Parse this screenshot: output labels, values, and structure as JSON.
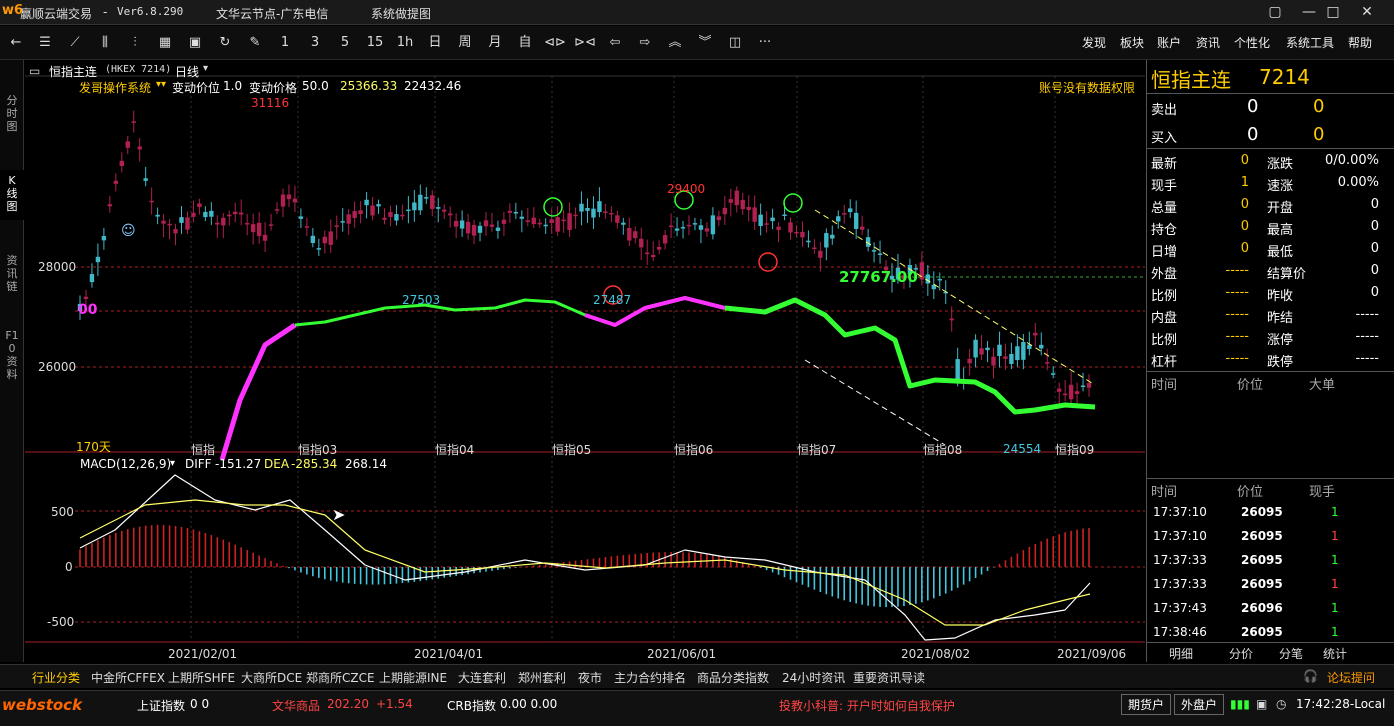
{
  "window": {
    "app_title": "赢顺云端交易",
    "version": "Ver6.8.290",
    "node": "文华云节点-广东电信",
    "notice": "系统做提图",
    "logo_text": "w6"
  },
  "toolbar": {
    "periods": [
      "1",
      "3",
      "5",
      "15",
      "1h",
      "日",
      "周",
      "月",
      "自"
    ],
    "menus": [
      "发现",
      "板块",
      "账户",
      "资讯",
      "个性化",
      "系统工具",
      "帮助"
    ]
  },
  "left_tabs": [
    "分时图",
    "K线图",
    "资讯链",
    "F10资料"
  ],
  "chart": {
    "contract": "恒指主连",
    "exchange": "(HKEX 7214)",
    "period": "日线",
    "indicator_name": "发哥操作系统",
    "tick_label": "变动价位",
    "tick_value": "1.0",
    "price_label": "变动价格",
    "price_value": "50.0",
    "val1": "25366.33",
    "val2": "22432.46",
    "no_permission": "账号没有数据权限",
    "day_count": "170天",
    "marker_left": "00",
    "annotations": {
      "high": "31116",
      "p1": "27503",
      "p2": "27487",
      "p3": "29400",
      "p4": "27767.00",
      "p5": "24554"
    },
    "y_labels": [
      "28000",
      "26000"
    ],
    "x_month_labels": [
      "恒指",
      "恒指03",
      "恒指04",
      "恒指05",
      "恒指06",
      "恒指07",
      "恒指08",
      "恒指09"
    ],
    "macd": {
      "name": "MACD(12,26,9)",
      "diff_label": "DIFF",
      "diff": "-151.27",
      "dea_label": "DEA",
      "dea": "-285.34",
      "macd_val": "268.14",
      "y_labels": [
        "500",
        "0",
        "-500"
      ]
    },
    "dates": [
      "2021/02/01",
      "2021/04/01",
      "2021/06/01",
      "2021/08/02",
      "2021/09/06"
    ],
    "colors": {
      "up": "#b02050",
      "down": "#40b8c8",
      "mid_line_up": "#ff33ff",
      "mid_line_down": "#33ff33",
      "diff": "#ffffff",
      "dea": "#ffff66"
    }
  },
  "quote_panel": {
    "name": "恒指主连",
    "code": "7214",
    "sell_label": "卖出",
    "sell_price": "0",
    "sell_vol": "0",
    "buy_label": "买入",
    "buy_price": "0",
    "buy_vol": "0",
    "rows": [
      {
        "l1": "最新",
        "v1": "0",
        "l2": "涨跌",
        "v2": "0/0.00%"
      },
      {
        "l1": "现手",
        "v1": "1",
        "l2": "速涨",
        "v2": "0.00%"
      },
      {
        "l1": "总量",
        "v1": "0",
        "l2": "开盘",
        "v2": "0"
      },
      {
        "l1": "持仓",
        "v1": "0",
        "l2": "最高",
        "v2": "0"
      },
      {
        "l1": "日增",
        "v1": "0",
        "l2": "最低",
        "v2": "0"
      },
      {
        "l1": "外盘",
        "v1": "-----",
        "l2": "结算价",
        "v2": "0"
      },
      {
        "l1": "比例",
        "v1": "-----",
        "l2": "昨收",
        "v2": "0"
      },
      {
        "l1": "内盘",
        "v1": "-----",
        "l2": "昨结",
        "v2": "-----"
      },
      {
        "l1": "比例",
        "v1": "-----",
        "l2": "涨停",
        "v2": "-----"
      },
      {
        "l1": "杠杆",
        "v1": "-----",
        "l2": "跌停",
        "v2": "-----"
      }
    ],
    "big_header": [
      "时间",
      "价位",
      "大单"
    ],
    "tick_header": [
      "时间",
      "价位",
      "现手"
    ],
    "ticks": [
      {
        "time": "17:37:10",
        "price": "26095",
        "vol": "1",
        "color": "#33ff33"
      },
      {
        "time": "17:37:10",
        "price": "26095",
        "vol": "1",
        "color": "#ff4444"
      },
      {
        "time": "17:37:33",
        "price": "26095",
        "vol": "1",
        "color": "#33ff33"
      },
      {
        "time": "17:37:33",
        "price": "26095",
        "vol": "1",
        "color": "#ff4444"
      },
      {
        "time": "17:37:43",
        "price": "26096",
        "vol": "1",
        "color": "#33ff33"
      },
      {
        "time": "17:38:46",
        "price": "26095",
        "vol": "1",
        "color": "#33ff33"
      }
    ],
    "bottom_tabs": [
      "明细",
      "分价",
      "分笔",
      "统计"
    ]
  },
  "market_tabs": [
    "行业分类",
    "中金所CFFEX",
    "上期所SHFE",
    "大商所DCE",
    "郑商所CZCE",
    "上期能源INE",
    "大连套利",
    "郑州套利",
    "夜市",
    "主力合约排名",
    "商品分类指数",
    "24小时资讯",
    "重要资讯导读"
  ],
  "forum": "论坛提问",
  "status": {
    "logo": "webstock",
    "idx1_name": "上证指数",
    "idx1_val": "0 0",
    "idx2_name": "文华商品",
    "idx2_val": "202.20",
    "idx2_chg": "+1.54",
    "idx3_name": "CRB指数",
    "idx3_val": "0.00 0.00",
    "tip": "投教小科普: 开户时如何自我保护",
    "btn_futures": "期货户",
    "btn_foreign": "外盘户",
    "clock": "17:42:28-Local"
  }
}
